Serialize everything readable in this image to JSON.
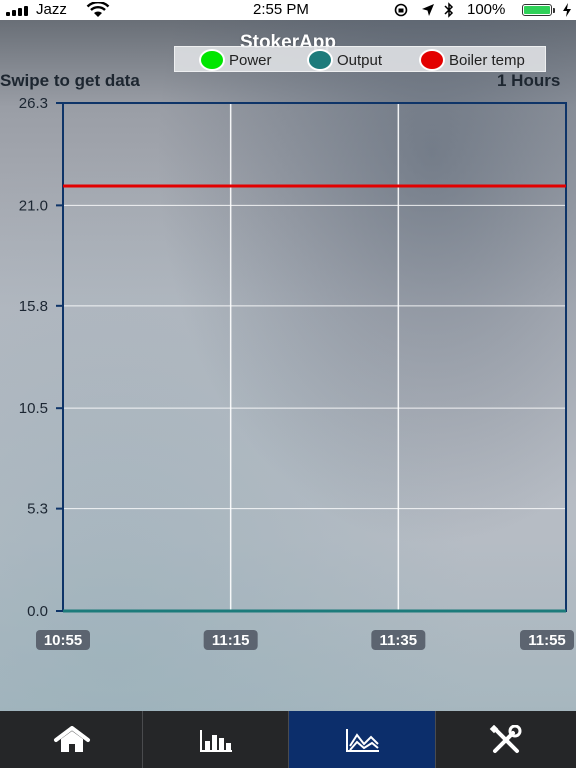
{
  "status_bar": {
    "carrier": "Jazz",
    "time": "2:55 PM",
    "battery_percent": "100%",
    "battery_level": 1.0
  },
  "app": {
    "title": "StokerApp"
  },
  "legend": [
    {
      "label": "Power",
      "color": "#00e600"
    },
    {
      "label": "Output",
      "color": "#1d7b7b"
    },
    {
      "label": "Boiler temp",
      "color": "#e30000"
    }
  ],
  "controls": {
    "swipe_hint": "Swipe to get data",
    "range": "1 Hours"
  },
  "chart_data": {
    "type": "line",
    "x": [
      "10:55",
      "11:15",
      "11:35",
      "11:55"
    ],
    "y_ticks": [
      "0.0",
      "5.3",
      "10.5",
      "15.8",
      "21.0",
      "26.3"
    ],
    "ylim": [
      0,
      26.3
    ],
    "xlim": [
      "10:55",
      "11:55"
    ],
    "grid": true,
    "legend_position": "top",
    "series": [
      {
        "name": "Power",
        "color": "#00e600",
        "x": [
          "10:55",
          "11:55"
        ],
        "values": [
          0,
          0
        ]
      },
      {
        "name": "Output",
        "color": "#1d7b7b",
        "x": [
          "10:55",
          "11:55"
        ],
        "values": [
          0,
          0
        ]
      },
      {
        "name": "Boiler temp",
        "color": "#e30000",
        "x": [
          "10:55",
          "11:55"
        ],
        "values": [
          22.0,
          22.0
        ]
      }
    ]
  },
  "tabs": [
    {
      "name": "tab-home",
      "icon": "home-icon",
      "active": false
    },
    {
      "name": "tab-stats",
      "icon": "bar-chart-icon",
      "active": false
    },
    {
      "name": "tab-chart",
      "icon": "line-chart-icon",
      "active": true
    },
    {
      "name": "tab-settings",
      "icon": "tools-icon",
      "active": false
    }
  ]
}
